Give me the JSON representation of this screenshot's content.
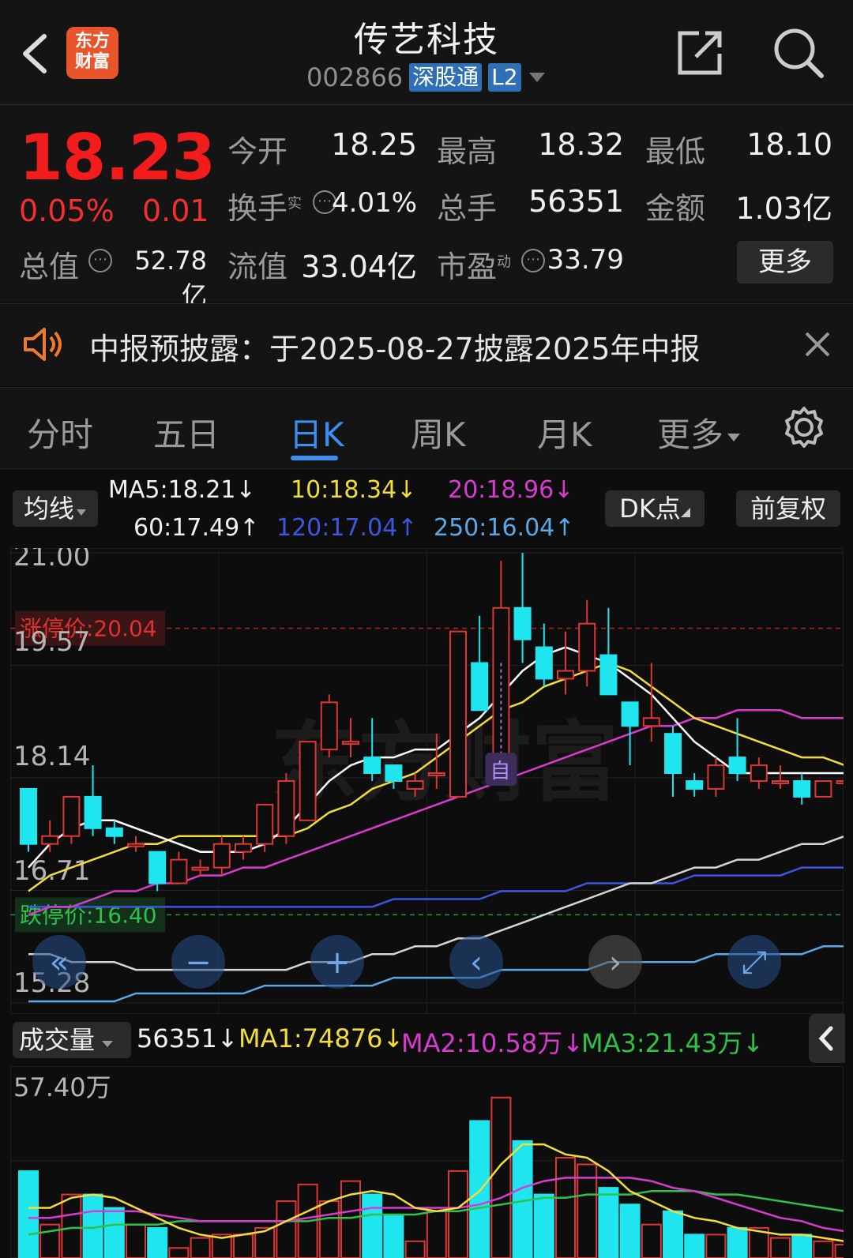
{
  "header": {
    "title": "传艺科技",
    "code": "002866",
    "tag1": "深股通",
    "tag2": "L2",
    "logo_line1": "东方",
    "logo_line2": "财富"
  },
  "quote": {
    "price": "18.23",
    "change_pct": "0.05%",
    "change": "0.01",
    "open_label": "今开",
    "open": "18.25",
    "high_label": "最高",
    "high": "18.32",
    "low_label": "最低",
    "low": "18.10",
    "turnover_label": "换手",
    "turnover_sup": "实",
    "turnover": "4.01%",
    "volume_label": "总手",
    "volume": "56351",
    "amount_label": "金额",
    "amount": "1.03亿",
    "mktcap_label": "总值",
    "mktcap": "52.78亿",
    "float_label": "流值",
    "float": "33.04亿",
    "pe_label": "市盈",
    "pe_sup": "动",
    "pe": "33.79",
    "more": "更多"
  },
  "notice": {
    "text": "中报预披露：于2025-08-27披露2025年中报"
  },
  "tabs": [
    "分时",
    "五日",
    "日K",
    "周K",
    "月K",
    "更多"
  ],
  "ma": {
    "selector": "均线",
    "ma5": "MA5:18.21↓",
    "ma10": "10:18.34↓",
    "ma20": "20:18.96↓",
    "ma60": "60:17.49↑",
    "ma120": "120:17.04↑",
    "ma250": "250:16.04↑",
    "dk": "DK点",
    "fq": "前复权"
  },
  "kline": {
    "y_labels": [
      "21.00",
      "19.57",
      "18.14",
      "16.71",
      "15.28"
    ],
    "limit_up": "涨停价:20.04",
    "limit_down": "跌停价:16.40",
    "marker": "自",
    "watermark": "东方财富"
  },
  "volume": {
    "selector": "成交量",
    "vol": "56351↓",
    "ma1": "MA1:74876↓",
    "ma2": "MA2:10.58万↓",
    "ma3": "MA3:21.43万↓",
    "y_label": "57.40万"
  },
  "chart_data": {
    "type": "candlestick",
    "y_range": [
      15.28,
      21.0
    ],
    "candles": [
      {
        "o": 18.0,
        "c": 17.3,
        "h": 18.0,
        "l": 17.2
      },
      {
        "o": 17.3,
        "c": 17.4,
        "h": 17.6,
        "l": 17.2
      },
      {
        "o": 17.4,
        "c": 17.9,
        "h": 17.9,
        "l": 17.3
      },
      {
        "o": 17.9,
        "c": 17.5,
        "h": 18.3,
        "l": 17.4
      },
      {
        "o": 17.5,
        "c": 17.4,
        "h": 17.6,
        "l": 17.3
      },
      {
        "o": 17.3,
        "c": 17.3,
        "h": 17.4,
        "l": 17.2
      },
      {
        "o": 17.2,
        "c": 16.8,
        "h": 17.2,
        "l": 16.7
      },
      {
        "o": 16.8,
        "c": 17.1,
        "h": 17.2,
        "l": 16.8
      },
      {
        "o": 17.0,
        "c": 17.0,
        "h": 17.1,
        "l": 16.9
      },
      {
        "o": 17.0,
        "c": 17.3,
        "h": 17.4,
        "l": 16.9
      },
      {
        "o": 17.2,
        "c": 17.3,
        "h": 17.4,
        "l": 17.1
      },
      {
        "o": 17.3,
        "c": 17.8,
        "h": 17.8,
        "l": 17.2
      },
      {
        "o": 17.4,
        "c": 18.1,
        "h": 18.2,
        "l": 17.3
      },
      {
        "o": 17.6,
        "c": 18.6,
        "h": 18.6,
        "l": 17.6
      },
      {
        "o": 18.5,
        "c": 19.1,
        "h": 19.2,
        "l": 18.4
      },
      {
        "o": 18.6,
        "c": 18.6,
        "h": 18.9,
        "l": 18.4
      },
      {
        "o": 18.4,
        "c": 18.2,
        "h": 18.9,
        "l": 18.1
      },
      {
        "o": 18.3,
        "c": 18.1,
        "h": 18.3,
        "l": 18.0
      },
      {
        "o": 18.0,
        "c": 18.1,
        "h": 18.2,
        "l": 17.9
      },
      {
        "o": 18.2,
        "c": 18.2,
        "h": 18.7,
        "l": 18.0
      },
      {
        "o": 17.9,
        "c": 20.0,
        "h": 20.0,
        "l": 17.9
      },
      {
        "o": 19.6,
        "c": 19.0,
        "h": 20.2,
        "l": 19.0
      },
      {
        "o": 18.4,
        "c": 20.3,
        "h": 20.9,
        "l": 18.4
      },
      {
        "o": 20.3,
        "c": 19.9,
        "h": 21.0,
        "l": 19.6
      },
      {
        "o": 19.8,
        "c": 19.4,
        "h": 20.1,
        "l": 19.3
      },
      {
        "o": 19.4,
        "c": 19.5,
        "h": 20.0,
        "l": 19.2
      },
      {
        "o": 19.5,
        "c": 20.1,
        "h": 20.4,
        "l": 19.3
      },
      {
        "o": 19.7,
        "c": 19.2,
        "h": 20.3,
        "l": 19.2
      },
      {
        "o": 19.1,
        "c": 18.8,
        "h": 19.1,
        "l": 18.3
      },
      {
        "o": 18.8,
        "c": 18.9,
        "h": 19.6,
        "l": 18.6
      },
      {
        "o": 18.7,
        "c": 18.2,
        "h": 18.8,
        "l": 17.9
      },
      {
        "o": 18.1,
        "c": 18.0,
        "h": 18.2,
        "l": 17.9
      },
      {
        "o": 18.0,
        "c": 18.3,
        "h": 18.4,
        "l": 17.9
      },
      {
        "o": 18.4,
        "c": 18.2,
        "h": 18.9,
        "l": 18.1
      },
      {
        "o": 18.1,
        "c": 18.3,
        "h": 18.4,
        "l": 18.0
      },
      {
        "o": 18.1,
        "c": 18.1,
        "h": 18.3,
        "l": 18.0
      },
      {
        "o": 18.1,
        "c": 17.9,
        "h": 18.2,
        "l": 17.8
      },
      {
        "o": 17.9,
        "c": 18.1,
        "h": 18.1,
        "l": 17.9
      },
      {
        "o": 18.1,
        "c": 18.1,
        "h": 18.3,
        "l": 17.9
      }
    ],
    "ma5": [
      17.0,
      17.3,
      17.5,
      17.6,
      17.6,
      17.5,
      17.4,
      17.3,
      17.2,
      17.2,
      17.2,
      17.3,
      17.5,
      17.8,
      18.1,
      18.3,
      18.4,
      18.4,
      18.5,
      18.5,
      18.7,
      18.9,
      19.2,
      19.5,
      19.7,
      19.8,
      19.7,
      19.6,
      19.4,
      19.2,
      18.9,
      18.6,
      18.4,
      18.2,
      18.2,
      18.2,
      18.2,
      18.2,
      18.2
    ],
    "ma10": [
      16.7,
      16.9,
      17.0,
      17.1,
      17.2,
      17.3,
      17.3,
      17.4,
      17.4,
      17.4,
      17.4,
      17.4,
      17.4,
      17.5,
      17.7,
      17.8,
      18.0,
      18.1,
      18.2,
      18.4,
      18.6,
      18.8,
      19.0,
      19.1,
      19.3,
      19.4,
      19.5,
      19.6,
      19.5,
      19.3,
      19.1,
      18.9,
      18.8,
      18.7,
      18.6,
      18.5,
      18.4,
      18.4,
      18.3
    ],
    "ma20": [
      16.4,
      16.5,
      16.5,
      16.6,
      16.7,
      16.7,
      16.8,
      16.8,
      16.9,
      16.9,
      17.0,
      17.0,
      17.1,
      17.2,
      17.3,
      17.4,
      17.5,
      17.6,
      17.7,
      17.8,
      17.9,
      18.0,
      18.1,
      18.2,
      18.3,
      18.4,
      18.5,
      18.6,
      18.7,
      18.8,
      18.8,
      18.9,
      18.9,
      19.0,
      19.0,
      19.0,
      18.9,
      18.9,
      18.9
    ],
    "ma60": [
      15.9,
      15.9,
      15.8,
      15.8,
      15.8,
      15.7,
      15.7,
      15.7,
      15.7,
      15.7,
      15.7,
      15.7,
      15.7,
      15.8,
      15.8,
      15.8,
      15.9,
      15.9,
      16.0,
      16.0,
      16.1,
      16.1,
      16.2,
      16.3,
      16.4,
      16.5,
      16.6,
      16.7,
      16.8,
      16.8,
      16.9,
      17.0,
      17.0,
      17.1,
      17.1,
      17.2,
      17.3,
      17.3,
      17.4
    ],
    "ma120": [
      16.5,
      16.5,
      16.5,
      16.5,
      16.5,
      16.5,
      16.5,
      16.5,
      16.5,
      16.5,
      16.5,
      16.5,
      16.5,
      16.5,
      16.5,
      16.5,
      16.5,
      16.6,
      16.6,
      16.6,
      16.6,
      16.6,
      16.7,
      16.7,
      16.7,
      16.7,
      16.8,
      16.8,
      16.8,
      16.8,
      16.8,
      16.9,
      16.9,
      16.9,
      16.9,
      16.9,
      17.0,
      17.0,
      17.0
    ],
    "ma250": [
      15.3,
      15.3,
      15.3,
      15.3,
      15.3,
      15.4,
      15.4,
      15.4,
      15.4,
      15.4,
      15.4,
      15.5,
      15.5,
      15.5,
      15.5,
      15.5,
      15.5,
      15.6,
      15.6,
      15.6,
      15.6,
      15.6,
      15.7,
      15.7,
      15.7,
      15.7,
      15.7,
      15.8,
      15.8,
      15.8,
      15.8,
      15.8,
      15.9,
      15.9,
      15.9,
      15.9,
      15.9,
      16.0,
      16.0
    ],
    "volume_max": 57.4,
    "volume_unit": "万",
    "volumes": [
      26,
      10,
      19,
      19,
      15,
      10,
      9,
      3,
      6,
      7,
      7,
      9,
      17,
      22,
      17,
      23,
      19,
      13,
      5,
      14,
      26,
      41,
      48,
      35,
      19,
      30,
      28,
      21,
      16,
      10,
      14,
      7,
      7,
      9,
      9,
      6,
      7,
      5,
      4
    ],
    "vol_ma1": [
      15,
      15,
      18,
      19,
      18,
      15,
      12,
      9,
      7,
      6,
      7,
      8,
      11,
      14,
      17,
      19,
      20,
      19,
      15,
      14,
      15,
      20,
      28,
      34,
      34,
      31,
      30,
      26,
      20,
      17,
      14,
      12,
      11,
      9,
      8,
      7,
      7,
      6,
      5
    ],
    "vol_ma2": [
      12,
      12,
      13,
      14,
      14,
      14,
      13,
      12,
      11,
      11,
      11,
      11,
      11,
      12,
      13,
      14,
      15,
      15,
      15,
      15,
      15,
      16,
      18,
      21,
      23,
      24,
      24,
      24,
      24,
      23,
      21,
      20,
      18,
      16,
      14,
      12,
      11,
      9,
      8
    ],
    "vol_ma3": [
      7,
      8,
      9,
      9,
      10,
      10,
      10,
      11,
      11,
      11,
      11,
      11,
      11,
      11,
      12,
      12,
      13,
      13,
      13,
      14,
      14,
      15,
      16,
      17,
      18,
      18,
      19,
      19,
      19,
      20,
      20,
      20,
      19,
      19,
      18,
      17,
      16,
      15,
      14
    ]
  }
}
